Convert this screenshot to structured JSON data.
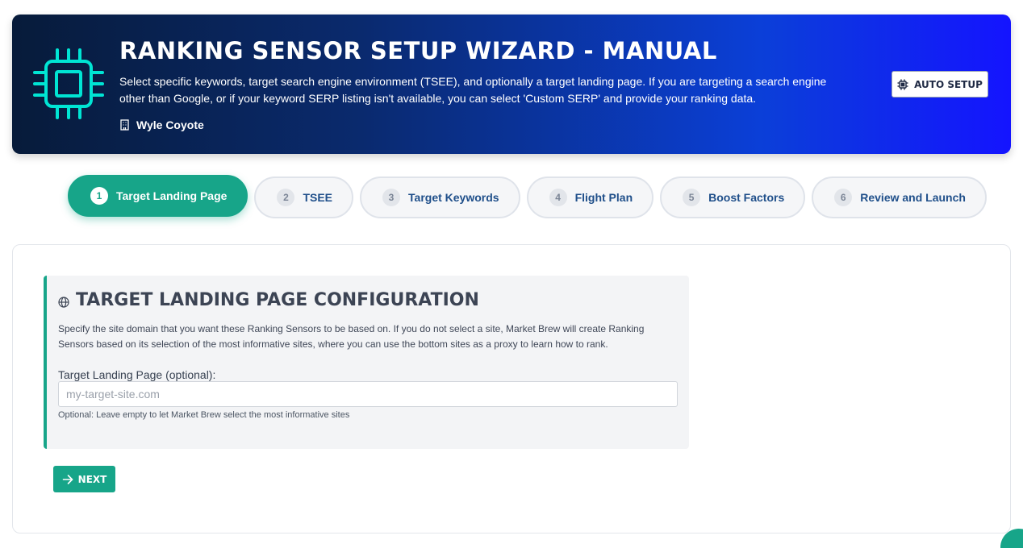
{
  "header": {
    "title": "Ranking Sensor Setup Wizard - Manual",
    "description": "Select specific keywords, target search engine environment (TSEE), and optionally a target landing page. If you are targeting a search engine other than Google, or if your keyword SERP listing isn't available, you can select 'Custom SERP' and provide your ranking data.",
    "user": "Wyle Coyote",
    "auto_setup_label": "Auto Setup",
    "icons": {
      "logo": "cpu-chip-icon",
      "user": "building-icon",
      "auto_setup": "cpu-chip-icon"
    },
    "accent_color": "#00e5d4"
  },
  "steps": [
    {
      "number": "1",
      "label": "Target Landing Page",
      "active": true
    },
    {
      "number": "2",
      "label": "TSEE",
      "active": false
    },
    {
      "number": "3",
      "label": "Target Keywords",
      "active": false
    },
    {
      "number": "4",
      "label": "Flight Plan",
      "active": false
    },
    {
      "number": "5",
      "label": "Boost Factors",
      "active": false
    },
    {
      "number": "6",
      "label": "Review and Launch",
      "active": false
    }
  ],
  "config": {
    "title": "Target Landing Page Configuration",
    "icon": "globe-icon",
    "description": "Specify the site domain that you want these Ranking Sensors to be based on. If you do not select a site, Market Brew will create Ranking Sensors based on its selection of the most informative sites, where you can use the bottom sites as a proxy to learn how to rank.",
    "field_label": "Target Landing Page (optional):",
    "field_placeholder": "my-target-site.com",
    "field_value": "",
    "field_help": "Optional: Leave empty to let Market Brew select the most informative sites"
  },
  "actions": {
    "next_label": "Next",
    "next_icon": "arrow-right-icon"
  },
  "colors": {
    "primary": "#17a589",
    "banner_start": "#071b3a",
    "banner_end": "#1414ff",
    "step_text": "#1f4f8a"
  }
}
